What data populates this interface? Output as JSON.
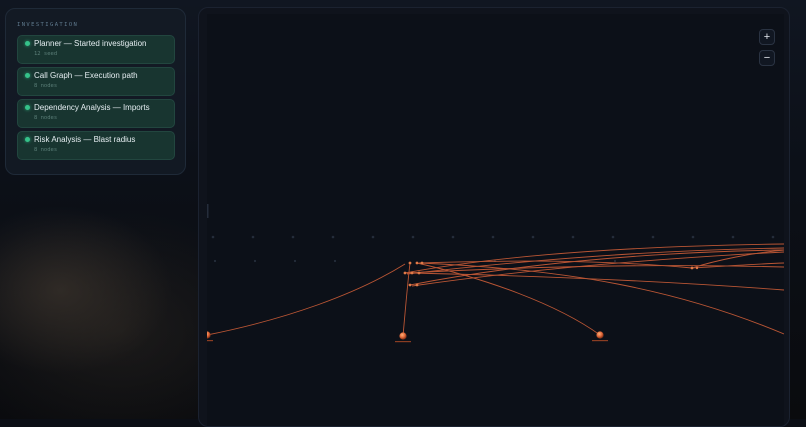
{
  "panel": {
    "title": "INVESTIGATION",
    "items": [
      {
        "title": "Planner — Started investigation",
        "subtitle": "12 seed"
      },
      {
        "title": "Call Graph — Execution path",
        "subtitle": "8 nodes"
      },
      {
        "title": "Dependency Analysis — Imports",
        "subtitle": "8 nodes"
      },
      {
        "title": "Risk Analysis — Blast radius",
        "subtitle": "8 nodes"
      }
    ]
  },
  "graph": {
    "zoom_in_label": "+",
    "zoom_out_label": "−"
  },
  "colors": {
    "accent": "#35c28a",
    "edge": "#d8623a",
    "node": "#e07a48",
    "card_bg": "#183530"
  }
}
